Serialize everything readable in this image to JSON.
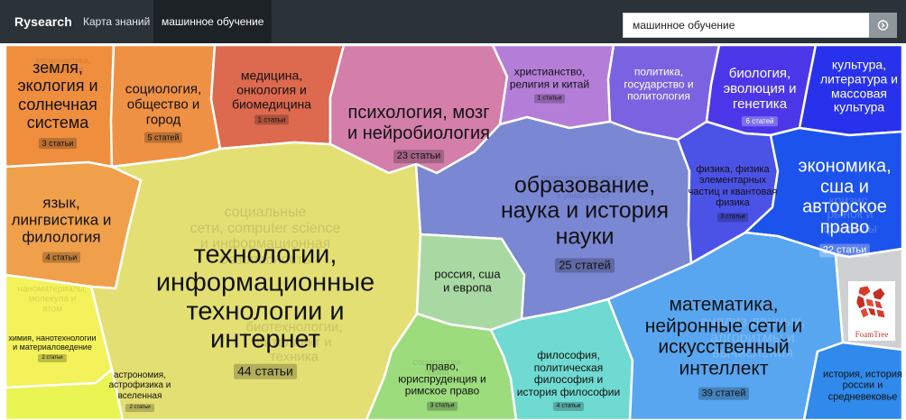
{
  "header": {
    "brand": "Rysearch",
    "nav": [
      {
        "label": "Карта знаний"
      },
      {
        "label": "машинное обучение"
      }
    ],
    "search_value": "машинное обучение"
  },
  "colors": {
    "nav_bg": "#2b3238",
    "active_tab": "#1d2227",
    "search_button": "#8f969c"
  },
  "logo": {
    "text": "FoamTree"
  },
  "clusters": [
    {
      "title": "земля, экология и солнечная система",
      "count": "3 статьи",
      "color": "#ef8e3d"
    },
    {
      "title": "социология, общество и город",
      "count": "5 статей",
      "color": "#ef9144"
    },
    {
      "title": "медицина, онкология и биомедицина",
      "count": "1 статьи",
      "color": "#dd6a4f"
    },
    {
      "title": "психология, мозг и нейробиология",
      "count": "23 статьи",
      "color": "#d37faa"
    },
    {
      "title": "христианство, религия и китай",
      "count": "1 статьи",
      "color": "#b47ed8"
    },
    {
      "title": "политика, государство и политология",
      "count": "",
      "color": "#7a63e0"
    },
    {
      "title": "биология, эволюция и генетика",
      "count": "6 статей",
      "color": "#4c37e8"
    },
    {
      "title": "культура, литература и массовая культура",
      "count": "",
      "color": "#2832ec"
    },
    {
      "title": "язык, лингвистика и филология",
      "count": "4 статьи",
      "color": "#f0a04a"
    },
    {
      "title": "технологии, информационные технологии и интернет",
      "count": "44 статьи",
      "color": "#e4df72"
    },
    {
      "title": "образование, наука и история науки",
      "count": "25 статей",
      "color": "#7a87d3"
    },
    {
      "title": "физика, физика элементарных частиц и квантовая физика",
      "count": "3 статьи",
      "color": "#4b52e6"
    },
    {
      "title": "экономика, сша и авторское право",
      "count": "22 статьи",
      "color": "#1c53ec"
    },
    {
      "title": "россия, сша и европа",
      "count": "",
      "color": "#a9d9a3"
    },
    {
      "title": "химия, нанотехнологии и материаловедение",
      "count": "2 статьи",
      "color": "#f3f25a"
    },
    {
      "title": "астрономия, астрофизика и вселенная",
      "count": "2 статьи",
      "color": "#e9f553"
    },
    {
      "title": "право, юриспруденция и римское право",
      "count": "3 статьи",
      "color": "#9cdc7d"
    },
    {
      "title": "философия, политическая философия и история философии",
      "count": "4 статьи",
      "color": "#6fdad1"
    },
    {
      "title": "математика, нейронные сети и искусственный интеллект",
      "count": "39 статей",
      "color": "#58a6f0"
    },
    {
      "title": "",
      "count": "",
      "color": "#cfd0d2"
    },
    {
      "title": "история, история россии и средневековье",
      "count": "",
      "color": "#2f8aeb"
    }
  ]
}
